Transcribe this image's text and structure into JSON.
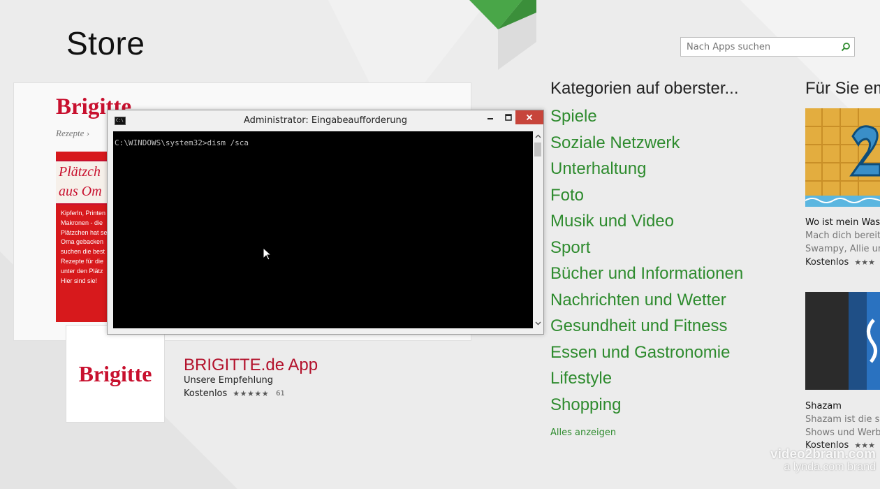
{
  "store": {
    "title": "Store"
  },
  "search": {
    "placeholder": "Nach Apps suchen"
  },
  "feature": {
    "logo": "Brigitte",
    "subtitle": "Rezepte ›",
    "plaque_line1": "Plätzch",
    "plaque_line2": "aus Om",
    "body_lines": [
      "Kipferln, Printen",
      "Makronen - die",
      "Plätzchen hat se",
      "Oma gebacken",
      "suchen die best",
      "Rezepte für die",
      "unter den Plätz",
      "Hier sind sie!"
    ]
  },
  "cmd": {
    "title": "Administrator: Eingabeaufforderung",
    "icon_text": "C:\\",
    "line": "C:\\WINDOWS\\system32>dism /sca"
  },
  "app": {
    "logo": "Brigitte",
    "name": "BRIGITTE.de App",
    "recommendation": "Unsere Empfehlung",
    "price": "Kostenlos",
    "stars": "★★★★★",
    "rating": 4.5,
    "rating_count": "61"
  },
  "categories": {
    "heading": "Kategorien auf oberster...",
    "items": [
      "Spiele",
      "Soziale Netzwerk",
      "Unterhaltung",
      "Foto",
      "Musik und Video",
      "Sport",
      "Bücher und Informationen",
      "Nachrichten und Wetter",
      "Gesundheit und Fitness",
      "Essen und Gastronomie",
      "Lifestyle",
      "Shopping"
    ],
    "show_all": "Alles anzeigen"
  },
  "recommendations": {
    "heading": "Für Sie em",
    "items": [
      {
        "title": "Wo ist mein Was",
        "desc1": "Mach dich bereit",
        "desc2": "Swampy, Allie und",
        "price": "Kostenlos",
        "stars": "★★★"
      },
      {
        "title": "Shazam",
        "desc1": "Shazam ist die sc",
        "desc2": "Shows und Werbe",
        "price": "Kostenlos",
        "stars": "★★★"
      }
    ]
  },
  "watermark": {
    "line1": "video2brain.com",
    "line2": "a lynda.com brand"
  },
  "colors": {
    "accent_green": "#2e8b2e",
    "brand_red": "#c8102e",
    "close_red": "#c7453b"
  }
}
